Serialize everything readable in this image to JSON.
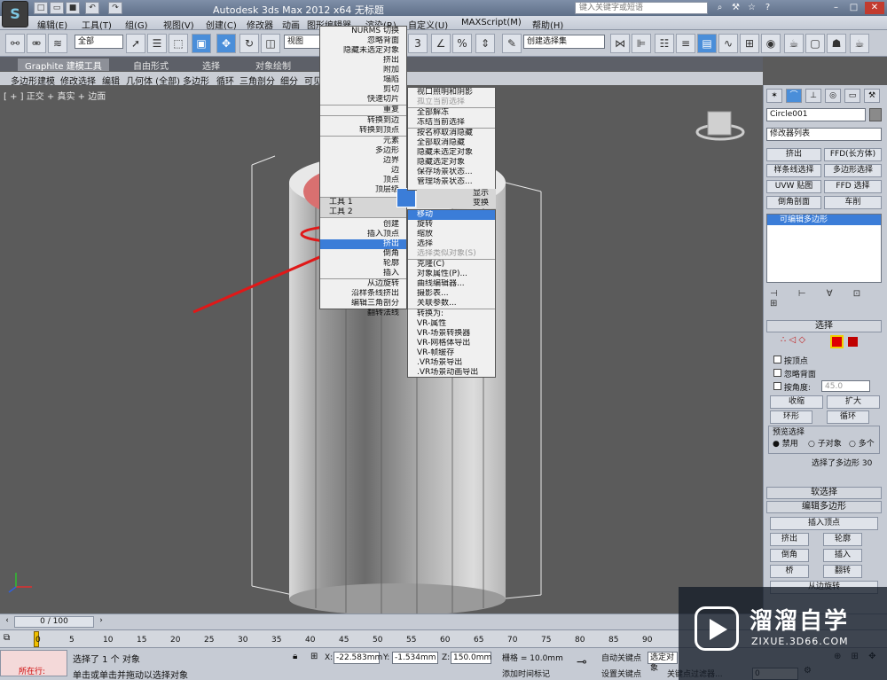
{
  "titlebar": {
    "logo": "S",
    "title": "Autodesk 3ds Max  2012 x64      无标题",
    "search_placeholder": "键入关键字或短语"
  },
  "menus": [
    "编辑(E)",
    "工具(T)",
    "组(G)",
    "视图(V)",
    "创建(C)",
    "修改器",
    "动画",
    "图形编辑器",
    "渲染(R)",
    "自定义(U)",
    "MAXScript(M)",
    "帮助(H)"
  ],
  "toolbar": {
    "filter_value": "全部",
    "view_value": "视图",
    "selection_set_value": "创建选择集"
  },
  "ribbon": {
    "tabs": [
      "Graphite 建模工具",
      "自由形式",
      "选择",
      "对象绘制"
    ],
    "items": [
      "多边形建模",
      "修改选择",
      "编辑",
      "几何体 (全部)",
      "多边形",
      "循环",
      "三角剖分",
      "细分",
      "可见"
    ]
  },
  "viewport": {
    "label": "[ + ] 正交 + 真实 + 边面"
  },
  "quadmenu": {
    "left_top": [
      "NURMS 切换",
      "忽略背面",
      "隐藏未选定对象",
      "挤出",
      "附加",
      "塌陷",
      "剪切",
      "快速切片",
      "重复",
      "转换到边",
      "转换到顶点",
      "元素",
      "多边形",
      "边界",
      "边",
      "顶点",
      "顶层级"
    ],
    "tools1": "工具 1",
    "tools2": "工具 2",
    "display": "显示",
    "transform": "变换",
    "left_bottom": [
      "创建",
      "插入顶点",
      "挤出",
      "倒角",
      "轮廓",
      "插入",
      "从边旋转",
      "沿样条线挤出",
      "编辑三角剖分",
      "翻转法线"
    ],
    "right_top": [
      "视口照明和阴影",
      "孤立当前选择",
      "全部解冻",
      "冻结当前选择",
      "按名称取消隐藏",
      "全部取消隐藏",
      "隐藏未选定对象",
      "隐藏选定对象",
      "保存场景状态...",
      "管理场景状态..."
    ],
    "right_bottom": [
      "移动",
      "旋转",
      "缩放",
      "选择",
      "选择类似对象(S)",
      "克隆(C)",
      "对象属性(P)...",
      "曲线编辑器...",
      "摄影表...",
      "关联参数...",
      "转换为:",
      "VR-属性",
      "VR-场景转换器",
      "VR-网格体导出",
      "VR-帧缓存",
      ".VR场景导出",
      ".VR场景动画导出"
    ]
  },
  "cmdpanel": {
    "object_name": "Circle001",
    "modifier_list": "修改器列表",
    "mod_buttons": [
      "挤出",
      "FFD(长方体)",
      "样条线选择",
      "多边形选择",
      "UVW 贴图",
      "FFD 选择",
      "倒角剖面",
      "车削"
    ],
    "stack_item": "可编辑多边形",
    "selection_title": "选择",
    "by_vertex": "按顶点",
    "ignore_backface": "忽略背面",
    "by_angle": "按角度:",
    "angle_value": "45.0",
    "shrink": "收缩",
    "grow": "扩大",
    "ring": "环形",
    "loop": "循环",
    "preview_title": "预览选择",
    "preview_options": [
      "禁用",
      "子对象",
      "多个"
    ],
    "selected_text": "选择了多边形 30",
    "soft_selection": "软选择",
    "edit_poly_title": "编辑多边形",
    "insert_vertex": "插入顶点",
    "edit_buttons": [
      "挤出",
      "轮廓",
      "倒角",
      "插入",
      "桥",
      "翻转"
    ],
    "from_edge": "从边旋转",
    "hinge_partial": "分",
    "flip_partial": "旋转"
  },
  "timeline": {
    "frame": "0 / 100",
    "ticks": [
      "0",
      "5",
      "10",
      "15",
      "20",
      "25",
      "30",
      "35",
      "40",
      "45",
      "50",
      "55",
      "60",
      "65",
      "70",
      "75",
      "80",
      "85",
      "90"
    ]
  },
  "status": {
    "mode": "所在行:",
    "selected": "选择了 1 个 对象",
    "hint": "单击或单击并拖动以选择对象",
    "x_label": "X:",
    "x": "-22.583mm",
    "y_label": "Y:",
    "y": "-1.534mm",
    "z_label": "Z:",
    "z": "150.0mm",
    "grid": "栅格 = 10.0mm",
    "auto_key": "自动关键点",
    "selected_obj": "选定对象",
    "set_key": "设置关键点",
    "key_filter": "关键点过滤器...",
    "add_time_tag": "添加时间标记",
    "frame_value": "0"
  },
  "watermark": {
    "brand": "溜溜自学",
    "url": "ZIXUE.3D66.COM"
  },
  "colors": {
    "highlight": "#3b7dd8",
    "arrow": "#e01818",
    "selection_red": "#e00000"
  }
}
